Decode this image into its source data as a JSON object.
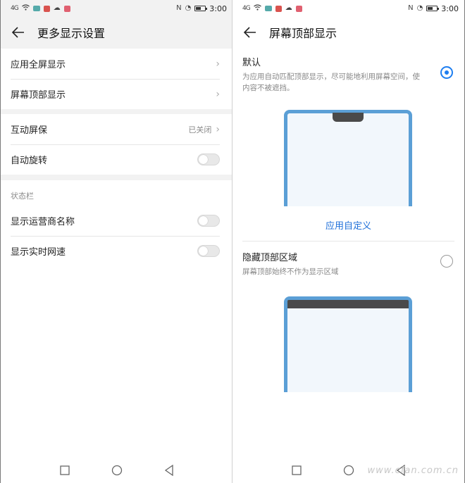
{
  "status_bar": {
    "signal": "4G",
    "time": "3:00"
  },
  "left": {
    "title": "更多显示设置",
    "group1": [
      {
        "label": "应用全屏显示"
      },
      {
        "label": "屏幕顶部显示"
      }
    ],
    "group2": [
      {
        "label": "互动屏保",
        "value": "已关闭"
      },
      {
        "label": "自动旋转",
        "toggle": false
      }
    ],
    "section_label": "状态栏",
    "group3": [
      {
        "label": "显示运营商名称",
        "toggle": false
      },
      {
        "label": "显示实时网速",
        "toggle": false
      }
    ]
  },
  "right": {
    "title": "屏幕顶部显示",
    "options": [
      {
        "title": "默认",
        "description": "为应用自动匹配顶部显示，尽可能地利用屏幕空间，使内容不被遮挡。",
        "selected": true
      },
      {
        "title": "隐藏顶部区域",
        "description": "屏幕顶部始终不作为显示区域",
        "selected": false
      }
    ],
    "custom_link": "应用自定义"
  },
  "watermark": "www.cfan.com.cn",
  "colors": {
    "accent": "#1e7ef0",
    "phone_frame": "#5b9fd6",
    "notch": "#4a4a4a"
  }
}
